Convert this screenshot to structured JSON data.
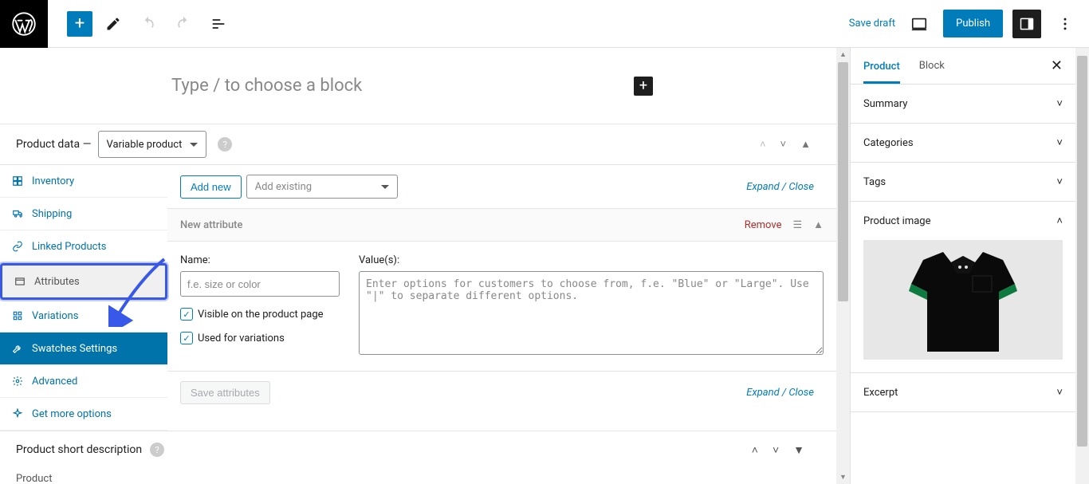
{
  "topbar": {
    "save_draft": "Save draft",
    "publish": "Publish"
  },
  "editor": {
    "block_placeholder": "Type / to choose a block"
  },
  "product_data": {
    "label": "Product data —",
    "type_selected": "Variable product",
    "tabs": {
      "inventory": "Inventory",
      "shipping": "Shipping",
      "linked": "Linked Products",
      "attributes": "Attributes",
      "variations": "Variations",
      "swatches": "Swatches Settings",
      "advanced": "Advanced",
      "more": "Get more options"
    },
    "add_new": "Add new",
    "add_existing": "Add existing",
    "expand_close": "Expand / Close",
    "attribute": {
      "panel_title": "New attribute",
      "remove": "Remove",
      "name_label": "Name:",
      "name_placeholder": "f.e. size or color",
      "values_label": "Value(s):",
      "values_placeholder": "Enter options for customers to choose from, f.e. \"Blue\" or \"Large\". Use \"|\" to separate different options.",
      "visible_label": "Visible on the product page",
      "used_label": "Used for variations",
      "save": "Save attributes"
    }
  },
  "short_desc": {
    "title": "Product short description"
  },
  "footer": {
    "product": "Product"
  },
  "sidebar": {
    "tab_product": "Product",
    "tab_block": "Block",
    "panels": {
      "summary": "Summary",
      "categories": "Categories",
      "tags": "Tags",
      "product_image": "Product image",
      "excerpt": "Excerpt"
    }
  }
}
